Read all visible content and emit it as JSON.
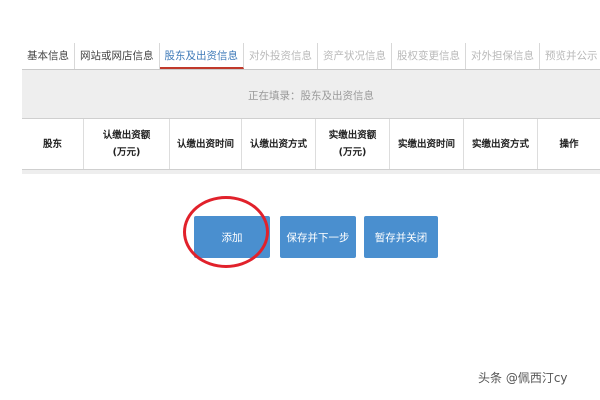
{
  "tabs": [
    {
      "label": "基本信息",
      "state": "normal"
    },
    {
      "label": "网站或网店信息",
      "state": "normal"
    },
    {
      "label": "股东及出资信息",
      "state": "active"
    },
    {
      "label": "对外投资信息",
      "state": "disabled"
    },
    {
      "label": "资产状况信息",
      "state": "disabled"
    },
    {
      "label": "股权变更信息",
      "state": "disabled"
    },
    {
      "label": "对外担保信息",
      "state": "disabled"
    },
    {
      "label": "预览并公示",
      "state": "disabled"
    }
  ],
  "editing_notice": "正在填录：股东及出资信息",
  "table": {
    "columns": [
      {
        "label": "股东"
      },
      {
        "label": "认缴出资额\n(万元)"
      },
      {
        "label": "认缴出资时间"
      },
      {
        "label": "认缴出资方式"
      },
      {
        "label": "实缴出资额\n(万元)"
      },
      {
        "label": "实缴出资时间"
      },
      {
        "label": "实缴出资方式"
      },
      {
        "label": "操作"
      }
    ],
    "rows": []
  },
  "buttons": {
    "add": "添加",
    "save_next": "保存并下一步",
    "save_close": "暂存并关闭"
  },
  "watermark": "头条 @佩西汀cy",
  "colors": {
    "accent": "#4a8fcf",
    "active_tab_underline": "#c0392b",
    "highlight_circle": "#e1212b"
  }
}
